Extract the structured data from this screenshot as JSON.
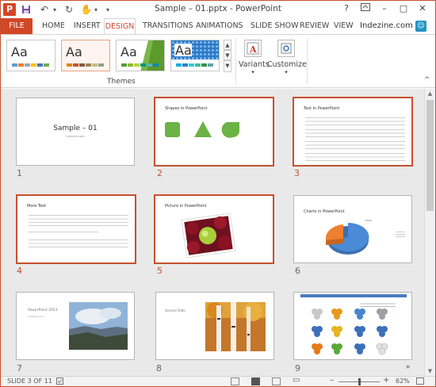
{
  "window": {
    "title": "Sample – 01.pptx - PowerPoint",
    "app_logo": "P",
    "controls": [
      "?",
      "□",
      "–",
      "□",
      "✕"
    ]
  },
  "qat": {
    "save_icon": "💾",
    "undo_icon": "↶",
    "redo_icon": "↻",
    "touch_icon": "✋",
    "more_icon": "▾"
  },
  "tabs": {
    "file": "FILE",
    "items": [
      "HOME",
      "INSERT",
      "DESIGN",
      "TRANSITIONS",
      "ANIMATIONS",
      "SLIDE SHOW",
      "REVIEW",
      "VIEW"
    ],
    "active": "DESIGN"
  },
  "user": {
    "name": "Indezine.com",
    "badge": "☺"
  },
  "ribbon": {
    "themes_label": "Themes",
    "theme_thumbs": [
      {
        "text": "Aa",
        "accent": "#ffffff"
      },
      {
        "text": "Aa",
        "accent": "#ffe3d8"
      },
      {
        "text": "Aa",
        "accent": "#7ab648"
      },
      {
        "text": "Aa",
        "accent": "#3d8fd4"
      }
    ],
    "variants_label": "Variants",
    "customize_label": "Customize"
  },
  "slides": [
    {
      "num": "1",
      "title": "Sample – 01",
      "subtitle": "Indezine.com"
    },
    {
      "num": "2",
      "title": "Shapes in PowerPoint"
    },
    {
      "num": "3",
      "title": "Text in PowerPoint"
    },
    {
      "num": "4",
      "title": "More Text"
    },
    {
      "num": "5",
      "title": "Picture in PowerPoint"
    },
    {
      "num": "6",
      "title": "Charts in PowerPoint"
    },
    {
      "num": "7",
      "title": "PowerPoint 2013",
      "subtitle": "Indezine.com"
    },
    {
      "num": "8",
      "title": "Second Slide"
    },
    {
      "num": "9",
      "title": ""
    }
  ],
  "selected_slides": [
    "2",
    "3",
    "4",
    "5"
  ],
  "status": {
    "slide_of": "SLIDE 3 OF 11",
    "zoom": "62%",
    "zoom_fraction": 0.62
  },
  "colors": {
    "accent": "#d24726",
    "selection": "#c6502f",
    "shape_green": "#6ab344",
    "pie_blue": "#4b8ad6",
    "pie_orange": "#ef8030"
  }
}
